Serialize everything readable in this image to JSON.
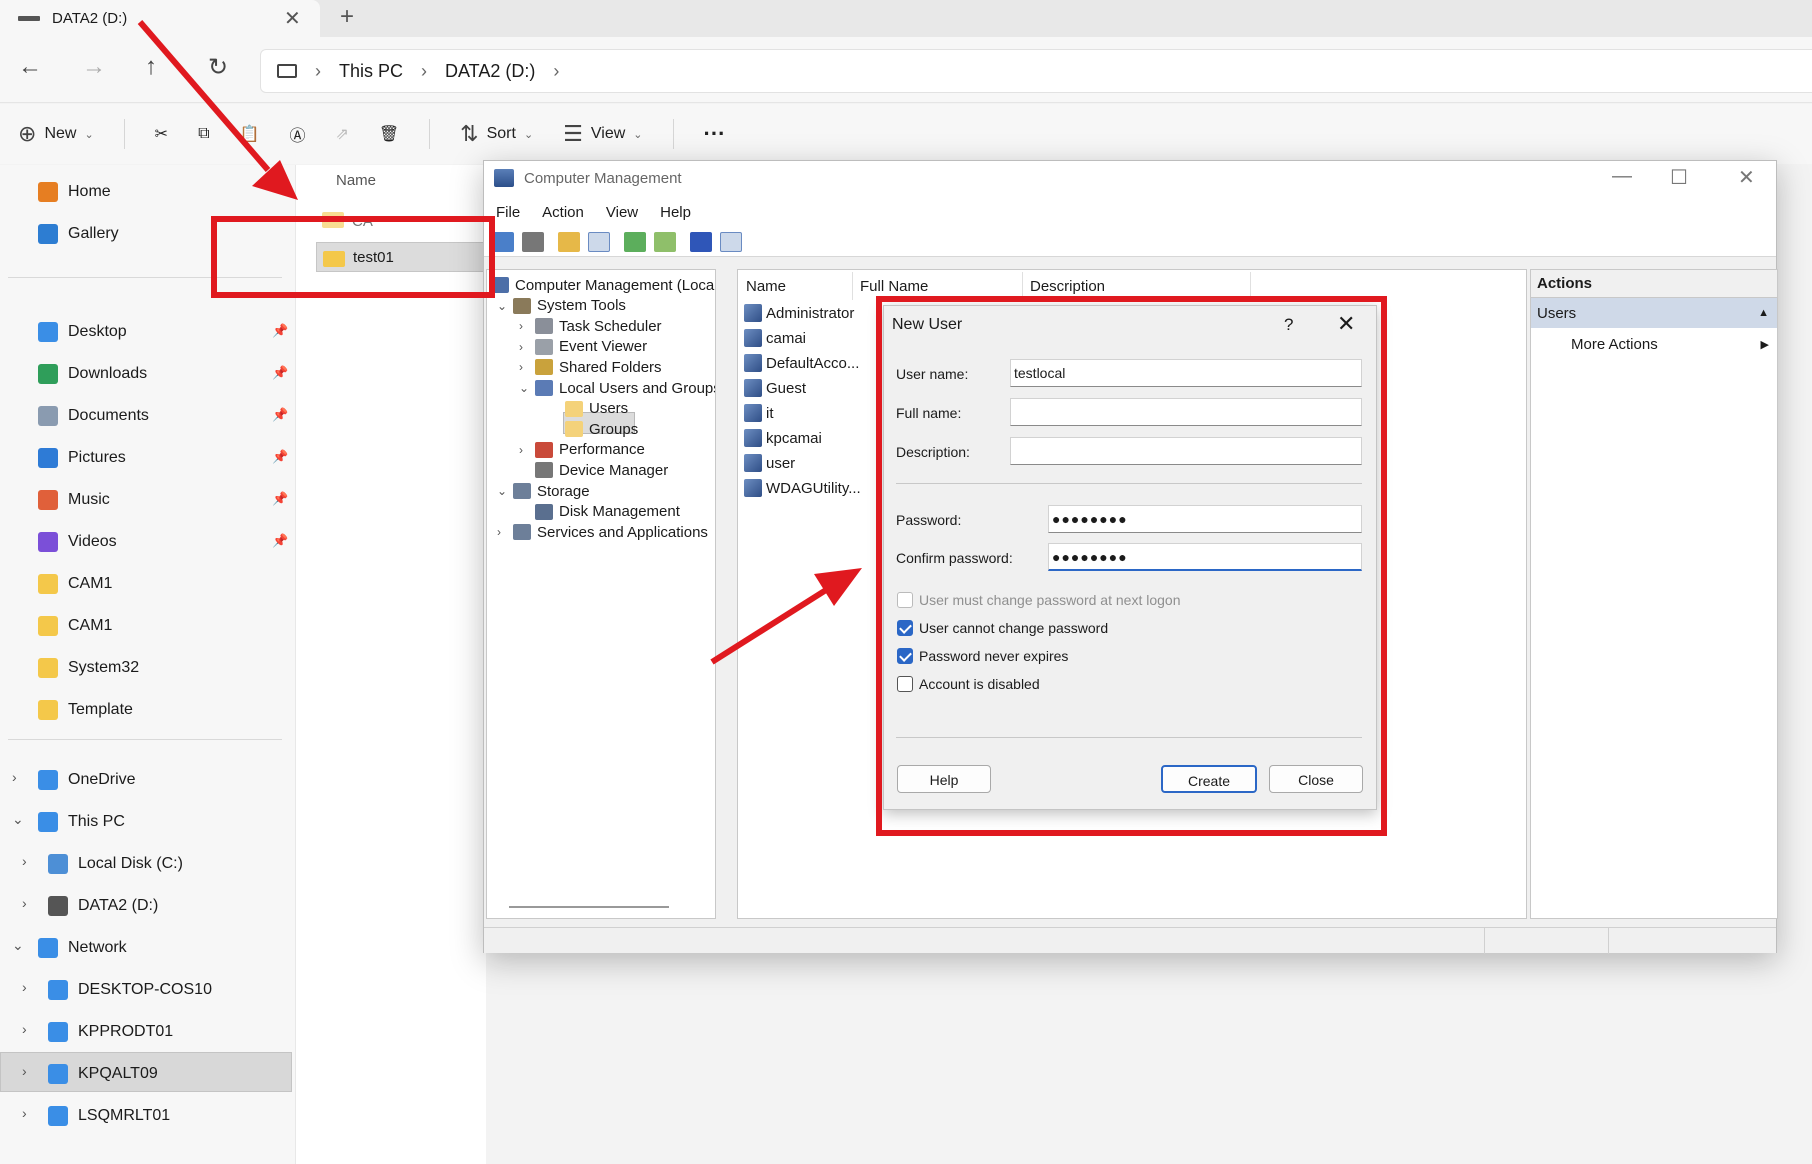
{
  "tab": {
    "title": "DATA2 (D:)",
    "close": "✕",
    "add": "+"
  },
  "address": {
    "crumbs": [
      "This PC",
      "DATA2 (D:)"
    ],
    "sep": "›"
  },
  "commands": {
    "new": "New",
    "sort": "Sort",
    "view": "View",
    "more": "···"
  },
  "sidebar": {
    "top": [
      {
        "label": "Home",
        "color": "#e67e22"
      },
      {
        "label": "Gallery",
        "color": "#2d7dd2"
      }
    ],
    "pinned": [
      {
        "label": "Desktop",
        "color": "#3a8ee6"
      },
      {
        "label": "Downloads",
        "color": "#2f9e5a"
      },
      {
        "label": "Documents",
        "color": "#8a9bb0"
      },
      {
        "label": "Pictures",
        "color": "#2e7bd6"
      },
      {
        "label": "Music",
        "color": "#e0603a"
      },
      {
        "label": "Videos",
        "color": "#7b4fd8"
      },
      {
        "label": "CAM1",
        "color": "#f4c84a"
      },
      {
        "label": "CAM1",
        "color": "#f4c84a"
      },
      {
        "label": "System32",
        "color": "#f4c84a"
      },
      {
        "label": "Template",
        "color": "#f4c84a"
      }
    ],
    "tree": [
      {
        "label": "OneDrive",
        "indent": 0,
        "chev": "›",
        "color": "#3a8ee6"
      },
      {
        "label": "This PC",
        "indent": 0,
        "chev": "⌄",
        "color": "#3a8ee6"
      },
      {
        "label": "Local Disk (C:)",
        "indent": 1,
        "chev": "›",
        "color": "#4d8fd6"
      },
      {
        "label": "DATA2 (D:)",
        "indent": 1,
        "chev": "›",
        "color": "#555555"
      },
      {
        "label": "Network",
        "indent": 0,
        "chev": "⌄",
        "color": "#3a8ee6"
      },
      {
        "label": "DESKTOP-COS10",
        "indent": 1,
        "chev": "›",
        "color": "#3a8ee6"
      },
      {
        "label": "KPPRODT01",
        "indent": 1,
        "chev": "›",
        "color": "#3a8ee6"
      },
      {
        "label": "KPQALT09",
        "indent": 1,
        "chev": "›",
        "color": "#3a8ee6"
      },
      {
        "label": "LSQMRLT01",
        "indent": 1,
        "chev": "›",
        "color": "#3a8ee6"
      }
    ]
  },
  "files": {
    "column": "Name",
    "partial": "CA",
    "selected": "test01"
  },
  "cm": {
    "title": "Computer Management",
    "menu": [
      "File",
      "Action",
      "View",
      "Help"
    ],
    "tree": [
      {
        "label": "Computer Management (Local",
        "level": 0,
        "chev": ""
      },
      {
        "label": "System Tools",
        "level": 1,
        "chev": "⌄"
      },
      {
        "label": "Task Scheduler",
        "level": 2,
        "chev": "›"
      },
      {
        "label": "Event Viewer",
        "level": 2,
        "chev": "›"
      },
      {
        "label": "Shared Folders",
        "level": 2,
        "chev": "›"
      },
      {
        "label": "Local Users and Groups",
        "level": 2,
        "chev": "⌄"
      },
      {
        "label": "Users",
        "level": 3,
        "chev": ""
      },
      {
        "label": "Groups",
        "level": 3,
        "chev": ""
      },
      {
        "label": "Performance",
        "level": 2,
        "chev": "›"
      },
      {
        "label": "Device Manager",
        "level": 2,
        "chev": ""
      },
      {
        "label": "Storage",
        "level": 1,
        "chev": "⌄"
      },
      {
        "label": "Disk Management",
        "level": 2,
        "chev": ""
      },
      {
        "label": "Services and Applications",
        "level": 1,
        "chev": "›"
      }
    ],
    "columns": [
      "Name",
      "Full Name",
      "Description"
    ],
    "users": [
      "Administrator",
      "camai",
      "DefaultAcco...",
      "Guest",
      "it",
      "kpcamai",
      "user",
      "WDAGUtility..."
    ],
    "actions": {
      "header": "Actions",
      "section": "Users",
      "more": "More Actions"
    }
  },
  "dialog": {
    "title": "New User",
    "help_glyph": "?",
    "close_glyph": "✕",
    "user_name_label": "User name:",
    "user_name_value": "testlocal",
    "full_name_label": "Full name:",
    "description_label": "Description:",
    "password_label": "Password:",
    "password_value": "●●●●●●●●",
    "confirm_label": "Confirm password:",
    "confirm_value": "●●●●●●●●",
    "options": [
      {
        "label": "User must change password at next logon",
        "checked": false,
        "disabled": true
      },
      {
        "label": "User cannot change password",
        "checked": true,
        "disabled": false
      },
      {
        "label": "Password never expires",
        "checked": true,
        "disabled": false
      },
      {
        "label": "Account is disabled",
        "checked": false,
        "disabled": false
      }
    ],
    "help_button": "Help",
    "create_button": "Create",
    "close_button": "Close"
  },
  "annotation_color": "#e0191f"
}
